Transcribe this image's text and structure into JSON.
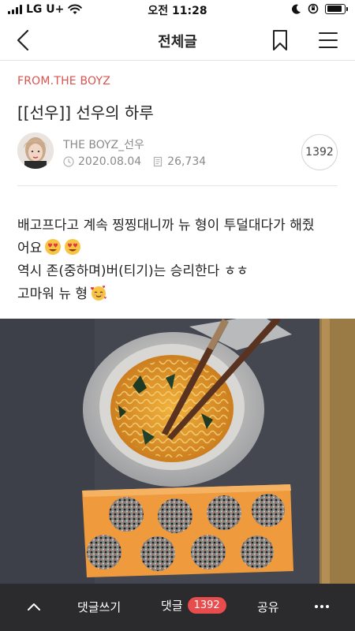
{
  "status_bar": {
    "carrier": "LG U+",
    "time": "오전 11:28",
    "battery_level": 0.9
  },
  "nav": {
    "title": "전체글",
    "icons": [
      "back-chevron-icon",
      "bookmark-icon",
      "hamburger-menu-icon"
    ]
  },
  "post": {
    "source": "FROM.THE BOYZ",
    "title": "[[선우]] 선우의 하루",
    "author": "THE BOYZ_선우",
    "date": "2020.08.04",
    "views": "26,734",
    "comment_count": "1392",
    "body_lines": [
      "배고프다고 계속 찡찡대니까 뉴 형이 투덜대다가 해줬",
      "어요",
      "역시 존(중하며)버(티기)는 승리한다 ㅎㅎ",
      "고마워 뉴 형"
    ],
    "image_description_icons": [
      "heart-eyes-emoji-icon",
      "smiling-hearts-emoji-icon"
    ]
  },
  "bottom_bar": {
    "write_comment": "댓글쓰기",
    "comments": "댓글",
    "comments_badge": "1392",
    "share": "공유"
  },
  "colors": {
    "accent": "#d9534f",
    "bottom_bar_bg": "#2b2b2d",
    "badge": "#e84c4c"
  }
}
